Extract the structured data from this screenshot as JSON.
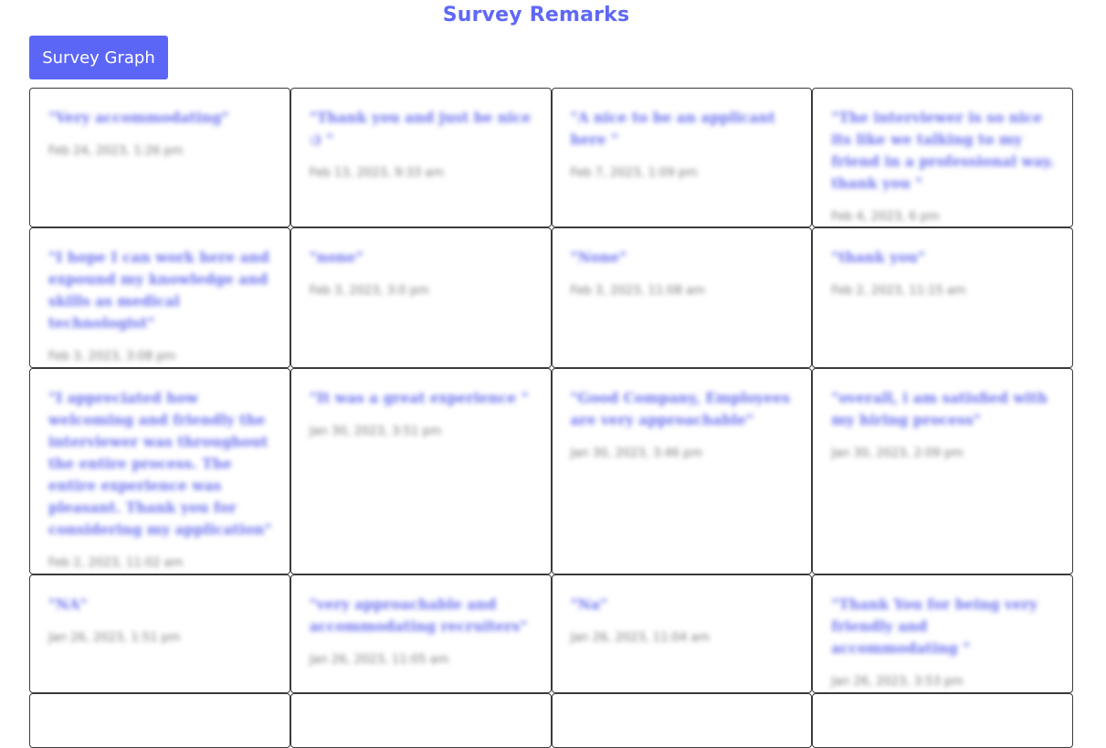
{
  "page": {
    "title": "Survey Remarks",
    "graph_button_label": "Survey Graph"
  },
  "colors": {
    "accent": "#5b66f7",
    "title": "#5f68f6",
    "remark_text": "#6a70ee",
    "card_border": "#3a3a3a"
  },
  "rows": [
    {
      "cards": [
        {
          "remark": "\"Very accommodating\"",
          "date": "Feb 24, 2023, 1:26 pm"
        },
        {
          "remark": "\"Thank you and just be nice :) \"",
          "date": "Feb 13, 2023, 9:33 am"
        },
        {
          "remark": "\"A nice to be an applicant here \"",
          "date": "Feb 7, 2023, 1:09 pm"
        },
        {
          "remark": "\"The interviewer is so nice its like we talking to my friend in a professional way. thank you \"",
          "date": "Feb 4, 2023, 6 pm"
        }
      ]
    },
    {
      "cards": [
        {
          "remark": "\"I hope I can work here and expound my knowledge and skills as medical technologist\"",
          "date": "Feb 3, 2023, 3:08 pm"
        },
        {
          "remark": "\"none\"",
          "date": "Feb 3, 2023, 3:0 pm"
        },
        {
          "remark": "\"None\"",
          "date": "Feb 3, 2023, 11:08 am"
        },
        {
          "remark": "\"thank you\"",
          "date": "Feb 2, 2023, 11:15 am"
        }
      ]
    },
    {
      "cards": [
        {
          "remark": "\"I appreciated how welcoming and friendly the interviewer was throughout the entire process. The entire experience was pleasant. Thank you for considering my application\"",
          "date": "Feb 2, 2023, 11:02 am"
        },
        {
          "remark": "\"It was a great experience \"",
          "date": "Jan 30, 2023, 3:51 pm"
        },
        {
          "remark": "\"Good Company, Employees are very approachable\"",
          "date": "Jan 30, 2023, 3:46 pm"
        },
        {
          "remark": "\"overall, i am satisfied with my hiring process\"",
          "date": "Jan 30, 2023, 2:09 pm"
        }
      ]
    },
    {
      "cards": [
        {
          "remark": "\"NA\"",
          "date": "Jan 26, 2023, 1:51 pm"
        },
        {
          "remark": "\"very approachable and accommodating recruiters\"",
          "date": "Jan 26, 2023, 11:05 am"
        },
        {
          "remark": "\"Na\"",
          "date": "Jan 26, 2023, 11:04 am"
        },
        {
          "remark": "\"Thank You for being very friendly and accommodating \"",
          "date": "Jan 26, 2023, 3:53 pm"
        }
      ]
    },
    {
      "cards": [
        {
          "remark": "",
          "date": ""
        },
        {
          "remark": "",
          "date": ""
        },
        {
          "remark": "",
          "date": ""
        },
        {
          "remark": "",
          "date": ""
        }
      ]
    }
  ]
}
